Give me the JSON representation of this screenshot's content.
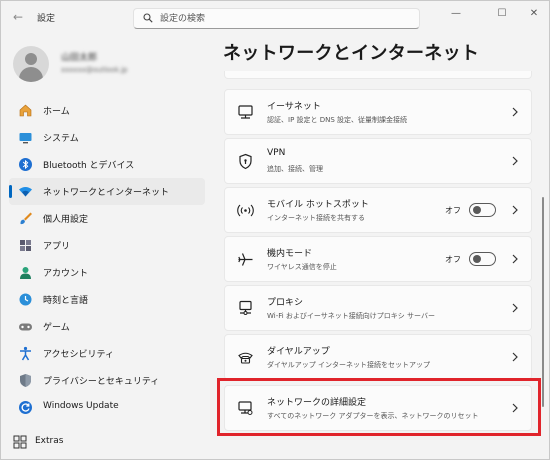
{
  "window": {
    "title": "設定",
    "back_glyph": "←",
    "controls": {
      "minimize": "—",
      "maximize": "☐",
      "close": "✕"
    }
  },
  "search": {
    "placeholder": "設定の検索",
    "value": ""
  },
  "profile": {
    "name": "山田太郎",
    "email": "xxxxxx@outlook.jp"
  },
  "sidebar": {
    "items": [
      {
        "label": "ホーム",
        "icon": "home-icon",
        "active": false
      },
      {
        "label": "システム",
        "icon": "system-icon",
        "active": false
      },
      {
        "label": "Bluetooth とデバイス",
        "icon": "bluetooth-icon",
        "active": false
      },
      {
        "label": "ネットワークとインターネット",
        "icon": "network-icon",
        "active": true
      },
      {
        "label": "個人用設定",
        "icon": "brush-icon",
        "active": false
      },
      {
        "label": "アプリ",
        "icon": "apps-icon",
        "active": false
      },
      {
        "label": "アカウント",
        "icon": "account-icon",
        "active": false
      },
      {
        "label": "時刻と言語",
        "icon": "globe-clock-icon",
        "active": false
      },
      {
        "label": "ゲーム",
        "icon": "gamepad-icon",
        "active": false
      },
      {
        "label": "アクセシビリティ",
        "icon": "accessibility-icon",
        "active": false
      },
      {
        "label": "プライバシーとセキュリティ",
        "icon": "shield-icon",
        "active": false
      },
      {
        "label": "Windows Update",
        "icon": "update-icon",
        "active": false
      }
    ],
    "extras": {
      "label": "Extras",
      "icon": "extras-grid-icon"
    }
  },
  "main": {
    "title": "ネットワークとインターネット",
    "cards": [
      {
        "title": "イーサネット",
        "subtitle": "認証、IP 設定と DNS 設定、従量制課金接続",
        "icon": "ethernet-icon"
      },
      {
        "title": "VPN",
        "subtitle": "追加、接続、管理",
        "icon": "vpn-shield-icon"
      },
      {
        "title": "モバイル ホットスポット",
        "subtitle": "インターネット接続を共有する",
        "icon": "hotspot-icon",
        "toggle_label": "オフ"
      },
      {
        "title": "機内モード",
        "subtitle": "ワイヤレス通信を停止",
        "icon": "airplane-icon",
        "toggle_label": "オフ"
      },
      {
        "title": "プロキシ",
        "subtitle": "Wi-Fi およびイーサネット接続向けプロキシ サーバー",
        "icon": "proxy-icon"
      },
      {
        "title": "ダイヤルアップ",
        "subtitle": "ダイヤルアップ インターネット接続をセットアップ",
        "icon": "dialup-icon"
      },
      {
        "title": "ネットワークの詳細設定",
        "subtitle": "すべてのネットワーク アダプターを表示、ネットワークのリセット",
        "icon": "advanced-network-icon"
      }
    ]
  },
  "colors": {
    "accent": "#0067c0",
    "highlight": "#e0242b",
    "background": "#f3f3f3",
    "card": "#fbfbfb"
  }
}
